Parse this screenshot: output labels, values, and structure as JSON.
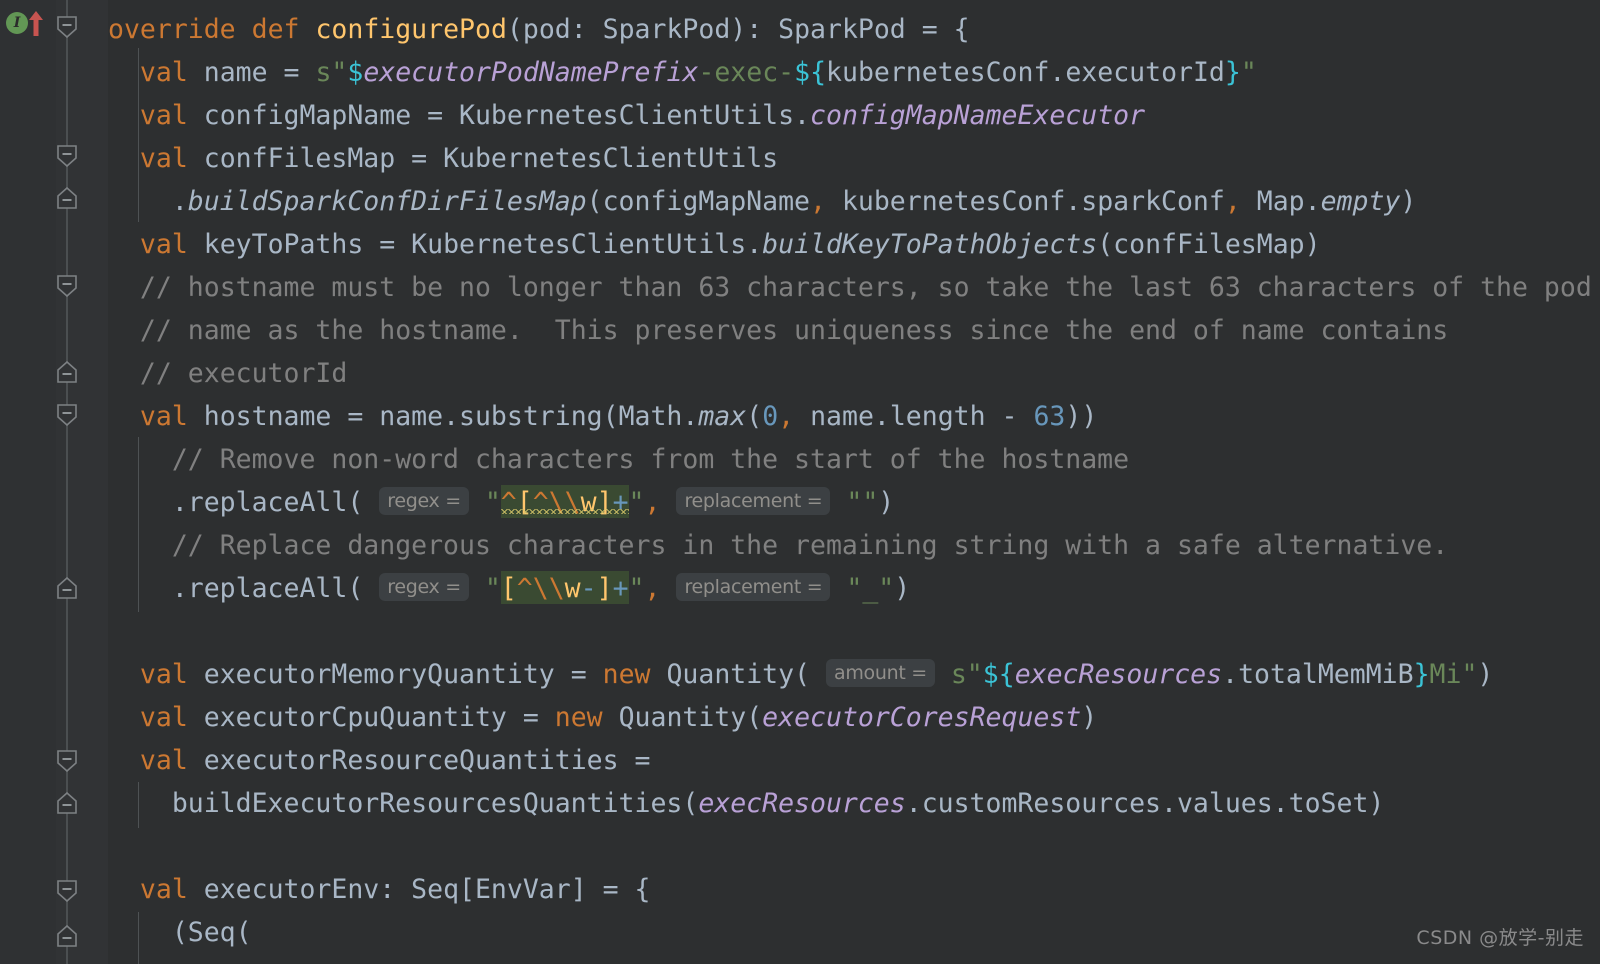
{
  "editor": {
    "theme_name": "darcula",
    "background": "#2d2f30",
    "gutter_background": "#313335",
    "default_text_color": "#a9b7c6"
  },
  "gutter": {
    "implements_marker": "I",
    "implements_marker_color": "#629755",
    "override_arrow_color": "#c75450",
    "fold_markers": [
      {
        "line": 1,
        "type": "fold-start"
      },
      {
        "line": 4,
        "type": "fold-start"
      },
      {
        "line": 5,
        "type": "fold-end"
      },
      {
        "line": 7,
        "type": "fold-start"
      },
      {
        "line": 9,
        "type": "fold-end"
      },
      {
        "line": 10,
        "type": "fold-start"
      },
      {
        "line": 14,
        "type": "fold-end"
      },
      {
        "line": 18,
        "type": "fold-start"
      },
      {
        "line": 19,
        "type": "fold-end"
      },
      {
        "line": 21,
        "type": "fold-start"
      },
      {
        "line": 22,
        "type": "fold-end"
      }
    ]
  },
  "code": {
    "language": "Scala",
    "lines": [
      "override def configurePod(pod: SparkPod): SparkPod = {",
      "  val name = s\"$executorPodNamePrefix-exec-${kubernetesConf.executorId}\"",
      "  val configMapName = KubernetesClientUtils.configMapNameExecutor",
      "  val confFilesMap = KubernetesClientUtils",
      "    .buildSparkConfDirFilesMap(configMapName, kubernetesConf.sparkConf, Map.empty)",
      "  val keyToPaths = KubernetesClientUtils.buildKeyToPathObjects(confFilesMap)",
      "  // hostname must be no longer than 63 characters, so take the last 63 characters of the pod",
      "  // name as the hostname.  This preserves uniqueness since the end of name contains",
      "  // executorId",
      "  val hostname = name.substring(Math.max(0, name.length - 63))",
      "    // Remove non-word characters from the start of the hostname",
      "    .replaceAll( regex = \"^[^\\\\w]+\", replacement = \"\")",
      "    // Replace dangerous characters in the remaining string with a safe alternative.",
      "    .replaceAll( regex = \"[^\\\\w-]+\", replacement = \"_\")",
      "",
      "  val executorMemoryQuantity = new Quantity( amount = s\"${execResources.totalMemMiB}Mi\")",
      "  val executorCpuQuantity = new Quantity(executorCoresRequest)",
      "  val executorResourceQuantities =",
      "    buildExecutorResourcesQuantities(execResources.customResources.values.toSet)",
      "",
      "  val executorEnv: Seq[EnvVar] = {",
      "    (Seq("
    ],
    "parameter_hints": [
      "regex =",
      "replacement =",
      "amount ="
    ],
    "highlighted_regex": [
      "^[^\\\\w]+",
      "[^\\\\w-]+"
    ],
    "numbers": [
      "0",
      "63"
    ],
    "token_colors": {
      "keyword": "#cc7832",
      "identifier": "#a9b7c6",
      "comment": "#808080",
      "string": "#6a8759",
      "number": "#6897bb",
      "interpolation": "#3bc3d6",
      "static_field": "#b9a1d6",
      "method_declaration": "#ffc66d",
      "regex_bracket": "#ffc66d",
      "regex_escape": "#cc7832",
      "regex_quantifier": "#6897bb",
      "regex_background": "#3a4a32",
      "param_hint_bg": "#3c4043",
      "param_hint_fg": "#918f8b"
    }
  },
  "watermark": {
    "text": "CSDN @放学-别走"
  }
}
